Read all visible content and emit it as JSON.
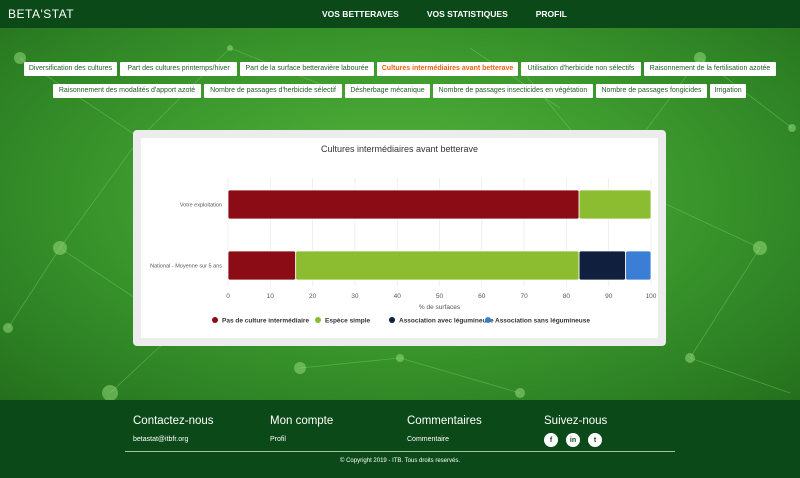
{
  "brand": "BETA'STAT",
  "nav": [
    "VOS BETTERAVES",
    "VOS STATISTIQUES",
    "PROFIL"
  ],
  "tabs": [
    "Diversification des cultures",
    "Part des cultures printemps/hiver",
    "Part de la surface betteravière labourée",
    "Cultures intermédiaires avant betterave",
    "Utilisation d'herbicide non sélectifs",
    "Raisonnement de la fertilisation azotée",
    "Raisonnement des modalités d'apport azoté",
    "Nombre de passages d'herbicide sélectif",
    "Désherbage mécanique",
    "Nombre de passages insecticides en végétation",
    "Nombre de passages fongicides",
    "Irrigation"
  ],
  "active_tab": "Cultures intermédiaires avant betterave",
  "chart_data": {
    "type": "bar",
    "orientation": "horizontal",
    "stacked": true,
    "title": "Cultures intermédiaires avant betterave",
    "categories": [
      "Votre exploitation",
      "National - Moyenne sur 5 ans"
    ],
    "series": [
      {
        "name": "Pas de culture intermédiaire",
        "color": "#8b0c14",
        "values": [
          83,
          16
        ]
      },
      {
        "name": "Espèce simple",
        "color": "#8cbc2f",
        "values": [
          17,
          67
        ]
      },
      {
        "name": "Association avec légumineuse",
        "color": "#0f1f3d",
        "values": [
          0,
          11
        ]
      },
      {
        "name": "Association sans légumineuse",
        "color": "#3a7fd5",
        "values": [
          0,
          6
        ]
      }
    ],
    "xlabel": "% de surfaces",
    "xlim": [
      0,
      100
    ],
    "xticks": [
      "0",
      "10",
      "20",
      "30",
      "40",
      "50",
      "60",
      "70",
      "80",
      "90",
      "100"
    ],
    "grid": true,
    "legend": "bottom"
  },
  "footer": {
    "contact_title": "Contactez-nous",
    "contact_email": "betastat@itbfr.org",
    "account_title": "Mon compte",
    "account_link": "Profil",
    "comments_title": "Commentaires",
    "comments_link": "Commentaire",
    "follow_title": "Suivez-nous",
    "social": [
      "f",
      "in",
      "t"
    ],
    "copyright": "© Copyright 2019 - ITB. Tous droits reservés."
  }
}
